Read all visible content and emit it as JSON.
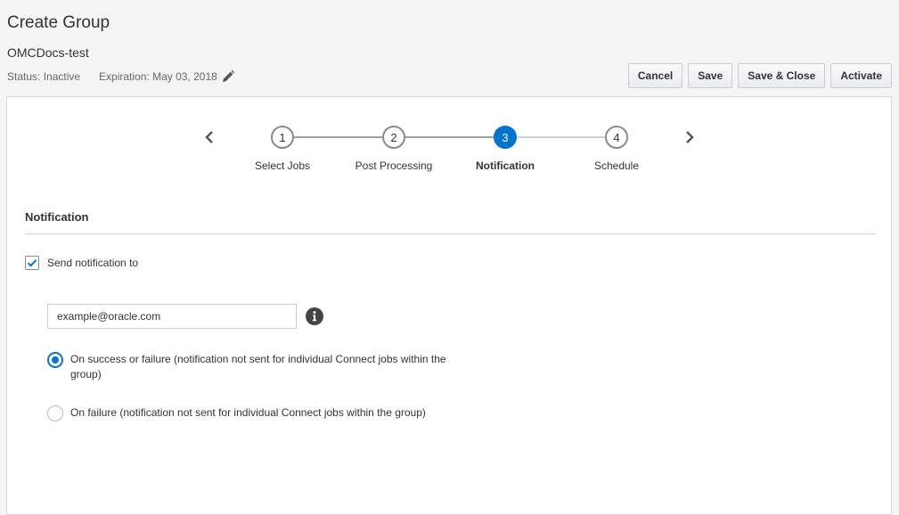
{
  "header": {
    "title": "Create Group",
    "group_name": "OMCDocs-test",
    "status": "Status: Inactive",
    "expiration": "Expiration: May 03, 2018"
  },
  "toolbar": {
    "cancel_label": "Cancel",
    "save_label": "Save",
    "save_close_label": "Save & Close",
    "activate_label": "Activate"
  },
  "train": {
    "steps": [
      {
        "number": "1",
        "label": "Select Jobs"
      },
      {
        "number": "2",
        "label": "Post Processing"
      },
      {
        "number": "3",
        "label": "Notification"
      },
      {
        "number": "4",
        "label": "Schedule"
      }
    ],
    "active_step": 3
  },
  "notification": {
    "section_title": "Notification",
    "send_checkbox_label": "Send notification to",
    "send_checked": true,
    "email_value": "example@oracle.com",
    "options": [
      {
        "label": "On success or failure (notification not sent for individual Connect jobs within the group)",
        "selected": true
      },
      {
        "label": "On failure (notification not sent for individual Connect jobs within the group)",
        "selected": false
      }
    ]
  },
  "colors": {
    "accent": "#0572ce",
    "icon_dark": "#444444"
  },
  "icons": {
    "edit": "pencil-icon",
    "info": "info-icon",
    "prev": "chevron-left-icon",
    "next": "chevron-right-icon",
    "check": "checkmark-icon"
  }
}
